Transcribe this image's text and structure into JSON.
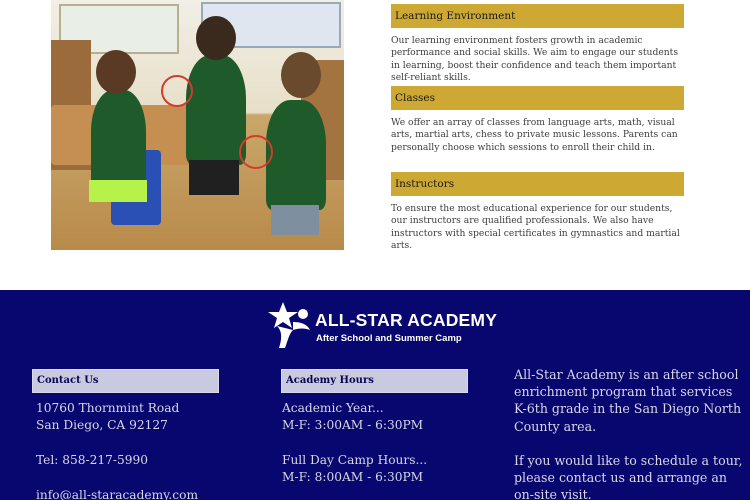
{
  "sections": [
    {
      "heading": "Learning Environment",
      "body": "Our learning environment fosters growth in academic performance and social skills. We aim to engage our students in learning, boost their confidence and teach them important self-reliant skills."
    },
    {
      "heading": "Classes",
      "body": "We offer an array of classes from language arts, math, visual arts, martial arts, chess to private music lessons. Parents can personally choose which sessions to enroll their child in."
    },
    {
      "heading": "Instructors",
      "body": "To ensure the most educational experience for our students, our instructors are qualified professionals.  We also have instructors with special certificates in gymnastics and martial arts."
    }
  ],
  "footer": {
    "brand": "ALL-STAR ACADEMY",
    "tagline": "After School and Summer Camp",
    "contact": {
      "heading": "Contact Us",
      "address_line1": "10760 Thornmint Road",
      "address_line2": "San Diego, CA 92127",
      "phone": "Tel: 858-217-5990",
      "email": "info@all-staracademy.com"
    },
    "hours": {
      "heading": "Academy Hours",
      "academic_label": "Academic Year...",
      "academic_hours": "M-F:  3:00AM - 6:30PM",
      "camp_label": "Full Day Camp Hours...",
      "camp_hours": "M-F:  8:00AM - 6:30PM"
    },
    "about": {
      "text": "All-Star Academy is an after school enrichment program that services K-6th grade in the San Diego North County area.",
      "cta": "If you would like to schedule a tour, please contact us and arrange an on-site visit."
    }
  },
  "icons": {
    "logo": "star-figure-logo-icon"
  },
  "colors": {
    "section_header": "#cda833",
    "footer_bg": "#07076f",
    "footer_header": "#c9cae0"
  }
}
